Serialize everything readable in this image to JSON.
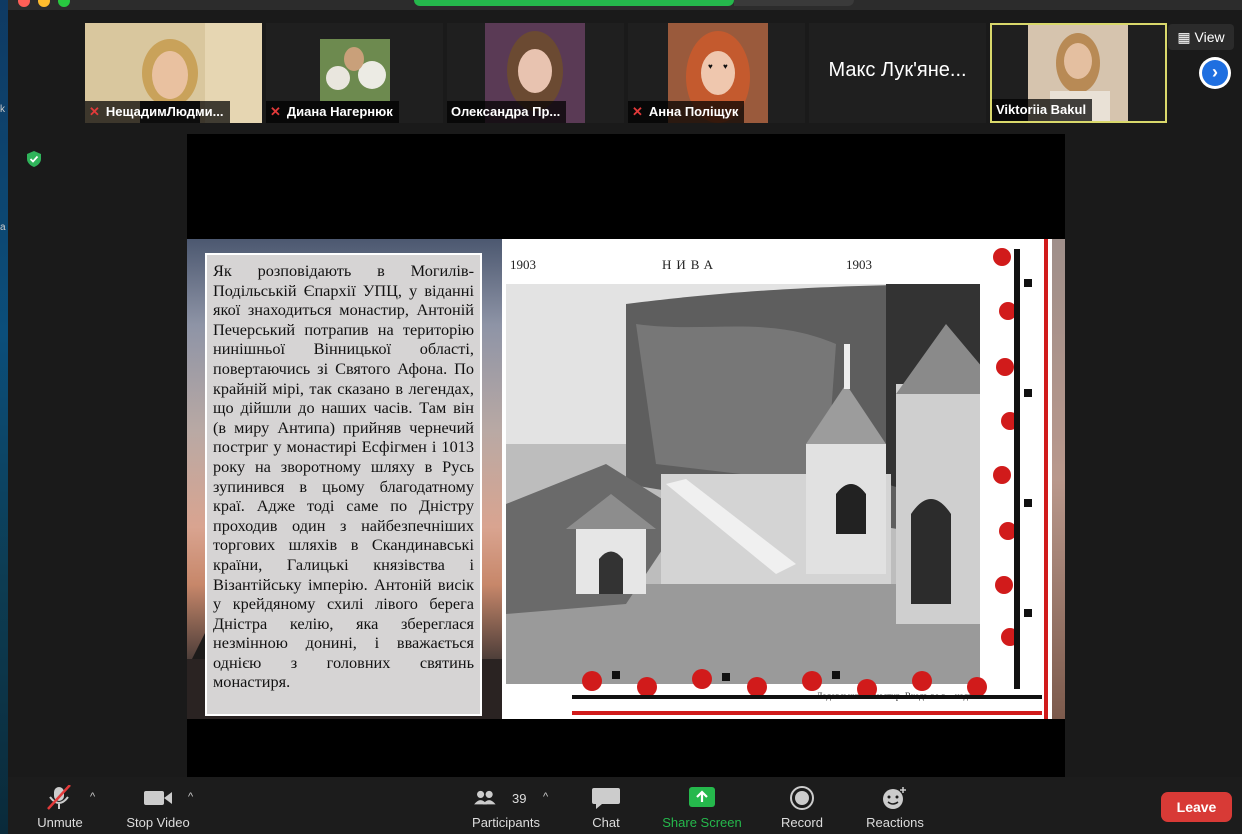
{
  "window": {
    "title_hidden": true
  },
  "gallery": {
    "tiles": [
      {
        "name": "НещадимЛюдми...",
        "muted": true
      },
      {
        "name": "Диана Нагернюк",
        "muted": true
      },
      {
        "name": "Олександра Пр...",
        "muted": false
      },
      {
        "name": "Анна Поліщук",
        "muted": true
      },
      {
        "name": "Макс Лук'яне...",
        "muted": false,
        "video": false
      },
      {
        "name": "Viktoriia Bakul",
        "muted": false,
        "active": true
      }
    ],
    "view_label": "View"
  },
  "slide": {
    "body_text": "Як розповідають в Могилів-Подільській Єпархії УПЦ, у віданні якої знаходиться монастир, Антоній Печерський потрапив на територію нинішньої Вінницької області, повертаючись зі Святого Афона. По крайній мірі, так сказано в легендах, що дійшли до наших часів. Там він (в миру Антипа) прийняв чернечий постриг у монастирі Есфігмен і 1013 року на зворотному шляху в Русь зупинився в цьому благодатному краї. Адже тоді саме по Дністру проходив один з найбезпечніших торгових шляхів в Скандинавські країни, Галицькі князівства і Візантійську імперію. Антоній висік у крейдяному схилі лівого берега Дністра келію, яка збереглася незмінною донині, і вважається однією з головних святинь монастиря.",
    "header_left": "1903",
    "header_center": "НИВА",
    "header_right": "1903",
    "caption": "Ладовський монастир. Входъ во в... надъ которымъ"
  },
  "toolbar": {
    "unmute": "Unmute",
    "stop_video": "Stop Video",
    "participants": "Participants",
    "participants_count": "39",
    "chat": "Chat",
    "share_screen": "Share Screen",
    "record": "Record",
    "reactions": "Reactions",
    "leave": "Leave"
  },
  "colors": {
    "share_green": "#25b84c",
    "leave_red": "#d83a36",
    "active_border": "#d9d86b",
    "next_blue": "#1f6fe0"
  }
}
